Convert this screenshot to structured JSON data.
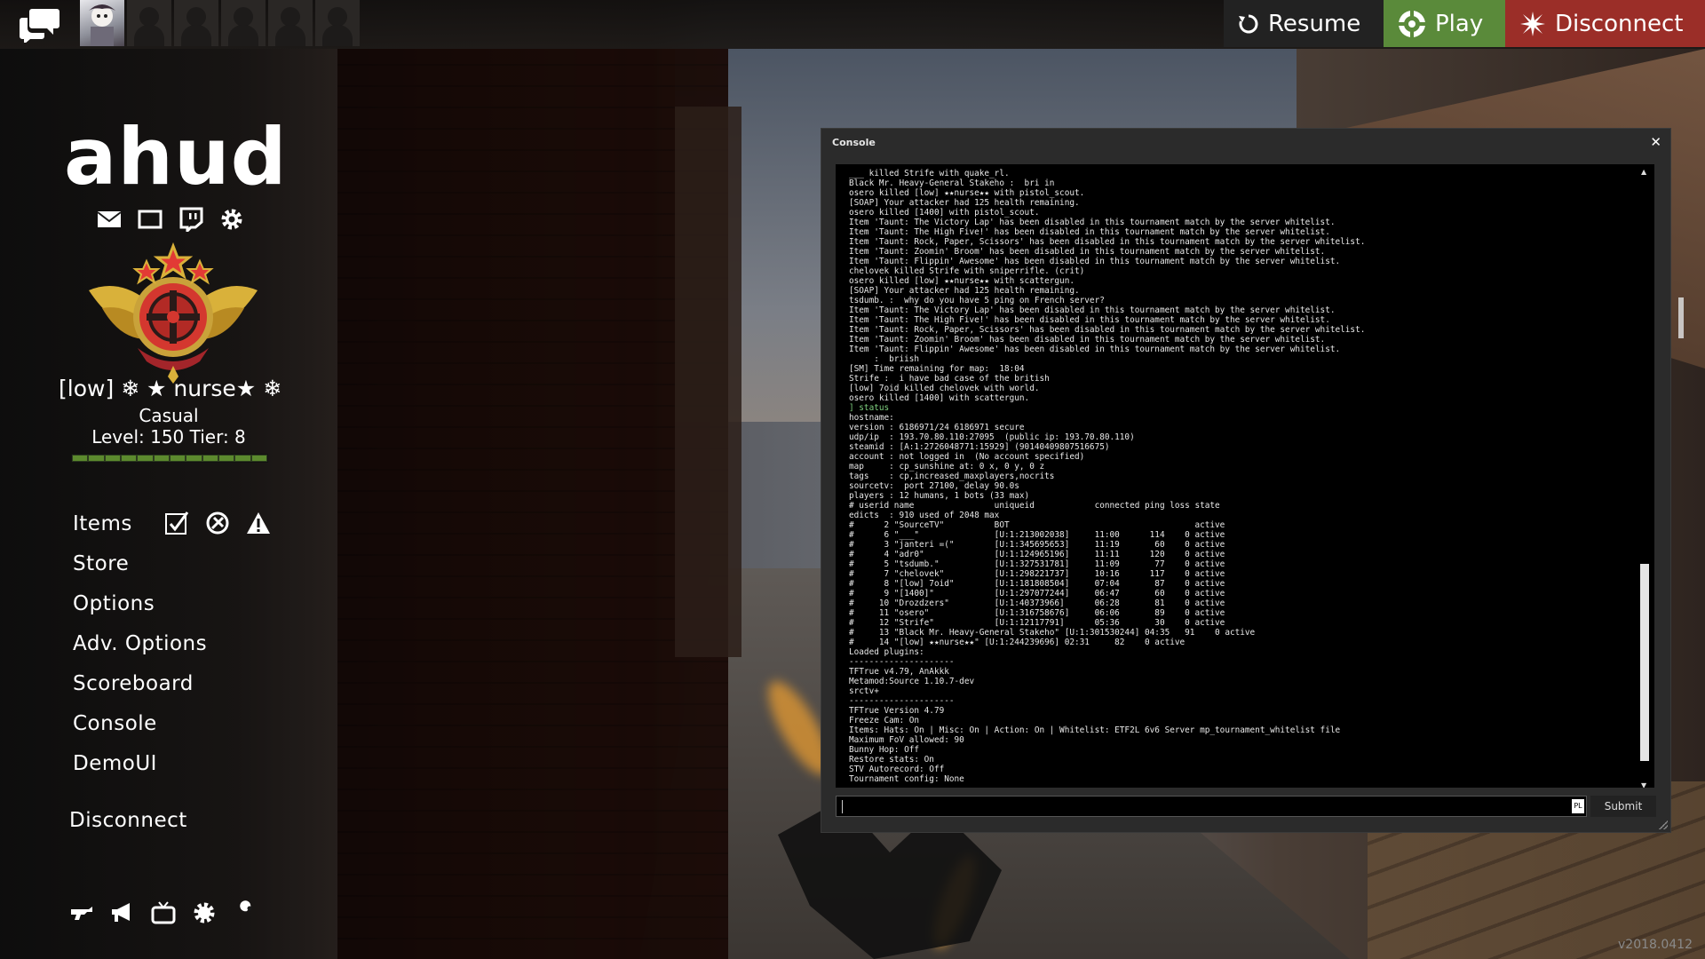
{
  "topbar": {
    "resume_label": "Resume",
    "play_label": "Play",
    "disconnect_label": "Disconnect"
  },
  "hud": {
    "logo": "ahud",
    "player_name": "[low] ❄ ★ nurse★ ❄",
    "mode": "Casual",
    "level": "Level: 150 Tier: 8",
    "xp_fraction": 1.0
  },
  "menu": {
    "items": "Items",
    "store": "Store",
    "options": "Options",
    "adv_options": "Adv. Options",
    "scoreboard": "Scoreboard",
    "console": "Console",
    "demoui": "DemoUI",
    "disconnect": "Disconnect"
  },
  "console": {
    "title": "Console",
    "close": "✕",
    "submit_label": "Submit",
    "lang": "PL",
    "output_lines": [
      "___ killed Strife with quake_rl.",
      "Black Mr. Heavy-General Stakeho :  bri in",
      "osero killed [low] ★★nurse★★ with pistol_scout.",
      "[SOAP] Your attacker had 125 health remaining.",
      "osero killed [1400] with pistol_scout.",
      "Item 'Taunt: The Victory Lap' has been disabled in this tournament match by the server whitelist.",
      "Item 'Taunt: The High Five!' has been disabled in this tournament match by the server whitelist.",
      "Item 'Taunt: Rock, Paper, Scissors' has been disabled in this tournament match by the server whitelist.",
      "Item 'Taunt: Zoomin' Broom' has been disabled in this tournament match by the server whitelist.",
      "Item 'Taunt: Flippin' Awesome' has been disabled in this tournament match by the server whitelist.",
      "chelovek killed Strife with sniperrifle. (crit)",
      "osero killed [low] ★★nurse★★ with scattergun.",
      "[SOAP] Your attacker had 125 health remaining.",
      "tsdumb. :  why do you have 5 ping on French server?",
      "Item 'Taunt: The Victory Lap' has been disabled in this tournament match by the server whitelist.",
      "Item 'Taunt: The High Five!' has been disabled in this tournament match by the server whitelist.",
      "Item 'Taunt: Rock, Paper, Scissors' has been disabled in this tournament match by the server whitelist.",
      "Item 'Taunt: Zoomin' Broom' has been disabled in this tournament match by the server whitelist.",
      "Item 'Taunt: Flippin' Awesome' has been disabled in this tournament match by the server whitelist.",
      "     :  briish",
      "[SM] Time remaining for map:  18:04",
      "Strife :  i have bad case of the british",
      "[low] 7oid killed chelovek with world.",
      "osero killed [1400] with scattergun.",
      "] status",
      "hostname:",
      "version : 6186971/24 6186971 secure",
      "udp/ip  : 193.70.80.110:27095  (public ip: 193.70.80.110)",
      "steamid : [A:1:2726048771:15929] (90140409807516675)",
      "account : not logged in  (No account specified)",
      "map     : cp_sunshine at: 0 x, 0 y, 0 z",
      "tags    : cp,increased_maxplayers,nocrits",
      "sourcetv:  port 27100, delay 90.0s",
      "players : 12 humans, 1 bots (33 max)",
      "# userid name                uniqueid            connected ping loss state",
      "edicts  : 910 used of 2048 max",
      "#      2 \"SourceTV\"          BOT                                     active",
      "#      6 \"___\"               [U:1:213002038]     11:00      114    0 active",
      "#      3 \"janteri =(\"        [U:1:345695653]     11:19       60    0 active",
      "#      4 \"adr0\"              [U:1:124965196]     11:11      120    0 active",
      "#      5 \"tsdumb.\"           [U:1:327531781]     11:09       77    0 active",
      "#      7 \"chelovek\"          [U:1:298221737]     10:16      117    0 active",
      "#      8 \"[low] 7oid\"        [U:1:181808504]     07:04       87    0 active",
      "#      9 \"[1400]\"            [U:1:297077244]     06:47       60    0 active",
      "#     10 \"Drozdzers\"         [U:1:40373966]      06:28       81    0 active",
      "#     11 \"osero\"             [U:1:316758676]     06:06       89    0 active",
      "#     12 \"Strife\"            [U:1:12117791]      05:36       30    0 active",
      "#     13 \"Black Mr. Heavy-General Stakeho\" [U:1:301530244] 04:35   91    0 active",
      "#     14 \"[low] ★★nurse★★\" [U:1:244239696] 02:31     82    0 active",
      "Loaded plugins:",
      "---------------------",
      "TFTrue v4.79, AnAkkk",
      "Metamod:Source 1.10.7-dev",
      "srctv+",
      "---------------------",
      "TFTrue Version 4.79",
      "Freeze Cam: On",
      "Items: Hats: On | Misc: On | Action: On | Whitelist: ETF2L 6v6 Server mp_tournament_whitelist file",
      "Maximum FoV allowed: 90",
      "Bunny Hop: Off",
      "Restore stats: On",
      "STV Autorecord: Off",
      "Tournament config: None"
    ]
  },
  "version_text": "v2018.0412",
  "icons": {
    "chat": "chat-bubbles-icon",
    "mail": "mail-icon",
    "screen": "screen-icon",
    "twitch": "twitch-icon",
    "settings": "gear-icon",
    "medal": "medal-emblem"
  },
  "colors": {
    "play": "#5a8a3a",
    "disconnect": "#9b2e28",
    "resume": "#222222",
    "xp": "#5c8a2e"
  }
}
